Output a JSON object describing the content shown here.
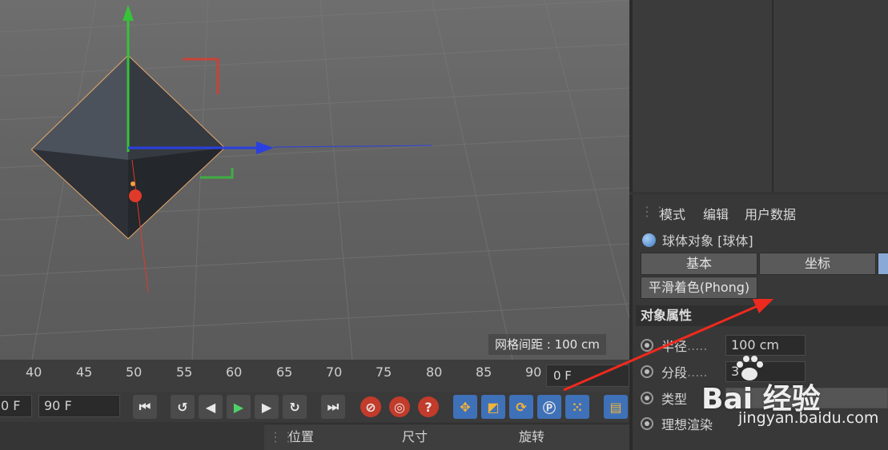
{
  "viewport": {
    "grid_readout": "网格间距 : 100 cm"
  },
  "timeline": {
    "ticks": [
      "40",
      "45",
      "50",
      "55",
      "60",
      "65",
      "70",
      "75",
      "80",
      "85",
      "90"
    ],
    "current_frame": "0 F"
  },
  "transport": {
    "start_field": "0 F",
    "end_field": "90 F",
    "buttons": [
      "go-start",
      "prev-key",
      "prev-frame",
      "play",
      "next-frame",
      "next-key",
      "go-end"
    ]
  },
  "coord_manager": {
    "col_position": "位置",
    "col_size": "尺寸",
    "col_rotation": "旋转"
  },
  "attributes": {
    "menu": [
      "模式",
      "编辑",
      "用户数据"
    ],
    "object_title": "球体对象 [球体]",
    "tabs": [
      "基本",
      "坐标"
    ],
    "tab_phong": "平滑着色(Phong)",
    "section_title": "对象属性",
    "radius_label": "半径",
    "radius_value": "100 cm",
    "segments_label": "分段",
    "segments_value": "3",
    "type_label": "类型",
    "ideal_label": "理想渲染"
  },
  "watermark": {
    "text": "Bai 经验",
    "url": "jingyan.baidu.com"
  },
  "colors": {
    "accent_blue": "#3f71b8",
    "axis_red": "#e03a2a",
    "axis_green": "#37c23a",
    "axis_blue": "#2a40e0",
    "annotation_red": "#ee2a1e"
  }
}
